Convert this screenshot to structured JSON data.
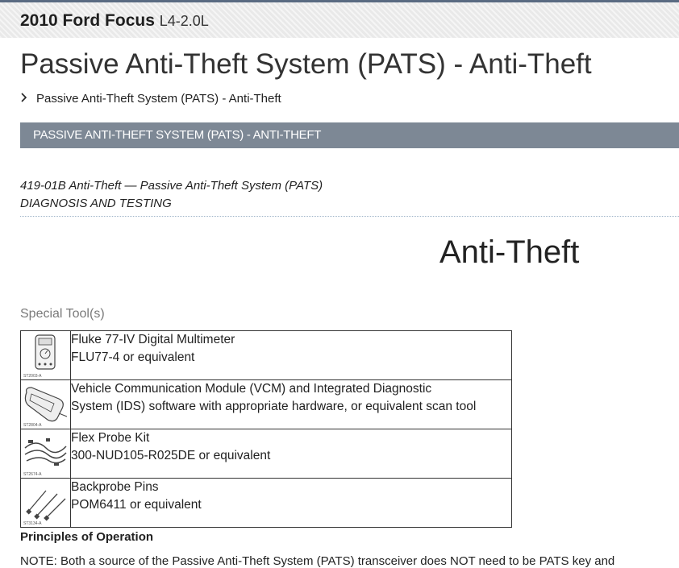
{
  "header": {
    "vehicle": "2010 Ford Focus",
    "engine": "L4-2.0L"
  },
  "page_title": "Passive Anti-Theft System (PATS) - Anti-Theft",
  "breadcrumb": {
    "item": "Passive Anti-Theft System (PATS) - Anti-Theft"
  },
  "section_bar": "PASSIVE ANTI-THEFT SYSTEM (PATS) - ANTI-THEFT",
  "procedure": {
    "line1": "419-01B Anti-Theft — Passive Anti-Theft System (PATS)",
    "line2": "DIAGNOSIS AND TESTING"
  },
  "heading": "Anti-Theft",
  "special_tools": {
    "label": "Special Tool(s)",
    "items": [
      {
        "icon": "multimeter-icon",
        "code": "ST2003-A",
        "line1": "Fluke 77-IV Digital Multimeter",
        "line2": "FLU77-4 or equivalent"
      },
      {
        "icon": "vcm-icon",
        "code": "ST2804-A",
        "line1": "Vehicle Communication Module (VCM) and Integrated Diagnostic",
        "line2": "System (IDS) software with appropriate hardware, or equivalent scan tool"
      },
      {
        "icon": "probe-kit-icon",
        "code": "ST2674-A",
        "line1": "Flex Probe Kit",
        "line2": "300-NUD105-R025DE or equivalent"
      },
      {
        "icon": "backprobe-pins-icon",
        "code": "ST3134-A",
        "line1": "Backprobe Pins",
        "line2": "POM6411 or equivalent"
      }
    ]
  },
  "principles_heading": "Principles of Operation",
  "note_partial": "NOTE: Both a source of the Passive Anti-Theft System (PATS) transceiver does NOT need to be PATS key and"
}
